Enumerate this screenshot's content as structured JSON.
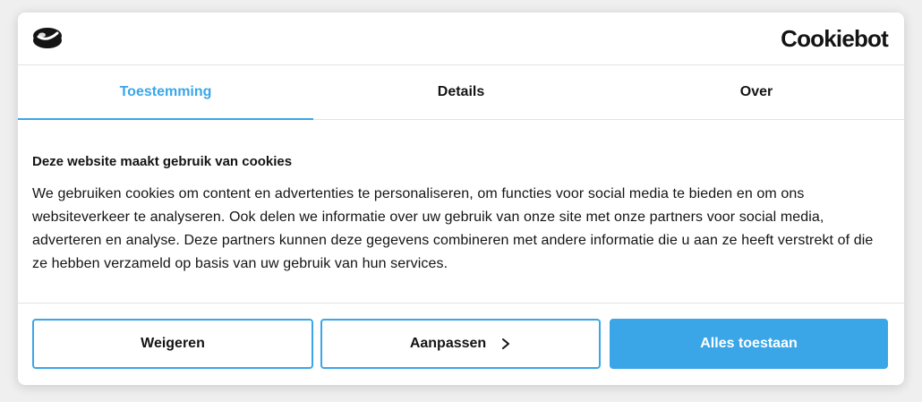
{
  "brand": {
    "name": "Cookiebot",
    "logo_icon": "cookie-icon"
  },
  "tabs": [
    {
      "label": "Toestemming",
      "active": true
    },
    {
      "label": "Details",
      "active": false
    },
    {
      "label": "Over",
      "active": false
    }
  ],
  "content": {
    "title": "Deze website maakt gebruik van cookies",
    "body": "We gebruiken cookies om content en advertenties te personaliseren, om functies voor social media te bieden en om ons websiteverkeer te analyseren. Ook delen we informatie over uw gebruik van onze site met onze partners voor social media, adverteren en analyse. Deze partners kunnen deze gegevens combineren met andere informatie die u aan ze heeft verstrekt of die ze hebben verzameld op basis van uw gebruik van hun services."
  },
  "buttons": {
    "deny": "Weigeren",
    "customize": "Aanpassen",
    "customize_icon": "chevron-right-icon",
    "allow_all": "Alles toestaan"
  },
  "colors": {
    "accent": "#3aa6e8",
    "text": "#141414",
    "background": "#ffffff"
  }
}
